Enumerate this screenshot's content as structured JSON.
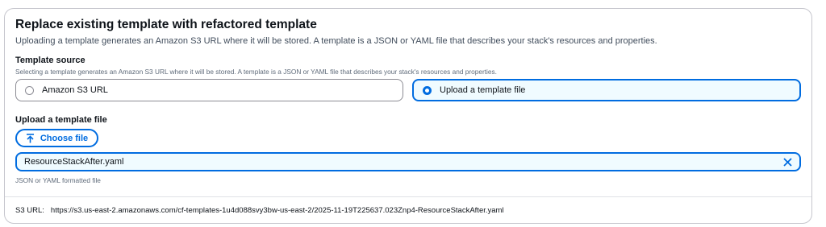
{
  "section": {
    "title": "Replace existing template with refactored template",
    "description": "Uploading a template generates an Amazon S3 URL where it will be stored. A template is a JSON or YAML file that describes your stack's resources and properties."
  },
  "template_source": {
    "label": "Template source",
    "hint": "Selecting a template generates an Amazon S3 URL where it will be stored. A template is a JSON or YAML file that describes your stack's resources and properties.",
    "options": [
      {
        "label": "Amazon S3 URL",
        "selected": false
      },
      {
        "label": "Upload a template file",
        "selected": true
      }
    ]
  },
  "upload": {
    "label": "Upload a template file",
    "choose_label": "Choose file",
    "file_name": "ResourceStackAfter.yaml",
    "hint": "JSON or YAML formatted file"
  },
  "s3": {
    "label": "S3 URL:",
    "url": "https://s3.us-east-2.amazonaws.com/cf-templates-1u4d088svy3bw-us-east-2/2025-11-19T225637.023Znp4-ResourceStackAfter.yaml"
  },
  "colors": {
    "accent": "#006ce0",
    "selected_bg": "#f0fbff",
    "border": "#c6c6cd"
  }
}
